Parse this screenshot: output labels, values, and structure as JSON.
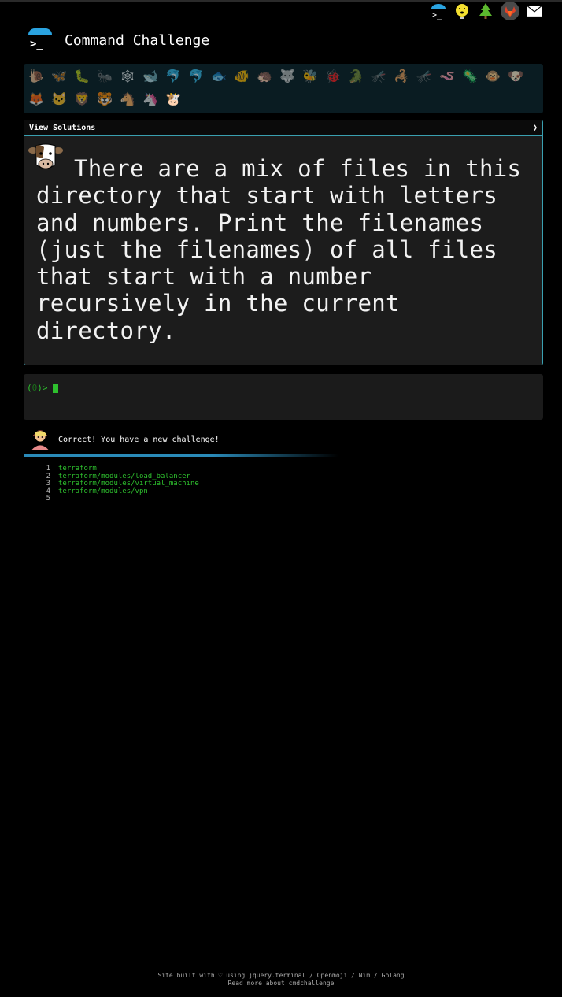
{
  "top_icons": [
    "terminal-icon",
    "lightbulb-face-icon",
    "tree-icon",
    "gitlab-icon",
    "mail-icon"
  ],
  "header": {
    "title": "Command Challenge",
    "logo_prompt": ">_"
  },
  "emoji_strip": {
    "row1": [
      "🐌",
      "🦋",
      "🐛",
      "🐜",
      "🕸",
      "🐋",
      "🐬",
      "🐬",
      "🐟",
      "🐠",
      "🦔",
      "🐺",
      "🐝",
      "🐞",
      "🐊",
      "🦟",
      "🦂",
      "🦟",
      "🪱",
      "🦠",
      "🐵",
      "🐶"
    ],
    "row2": [
      "🦊",
      "🐱",
      "🦁",
      "🐯",
      "🐴",
      "🦄",
      "🐮"
    ]
  },
  "challenge": {
    "solutions_label": "View Solutions",
    "chevron": "❯",
    "avatar": "🐮",
    "text": "There are a mix of files in this directory that start with letters and numbers. Print the filenames (just the filenames) of all files that start with a number recursively in the current directory."
  },
  "terminal": {
    "prompt_open": "(",
    "prompt_code": "0",
    "prompt_close": ")>"
  },
  "feedback": {
    "avatar": "🧝",
    "message": "Correct! You have a new challenge!"
  },
  "output": {
    "lines": [
      {
        "n": "1",
        "text": "terraform"
      },
      {
        "n": "2",
        "text": "terraform/modules/load_balancer"
      },
      {
        "n": "3",
        "text": "terraform/modules/virtual_machine"
      },
      {
        "n": "4",
        "text": "terraform/modules/vpn"
      },
      {
        "n": "5",
        "text": ""
      }
    ]
  },
  "footer": {
    "line1": "Site built with ♡ using jquery.terminal / Openmoji / Nim / Golang",
    "line2": "Read more about cmdchallenge"
  }
}
